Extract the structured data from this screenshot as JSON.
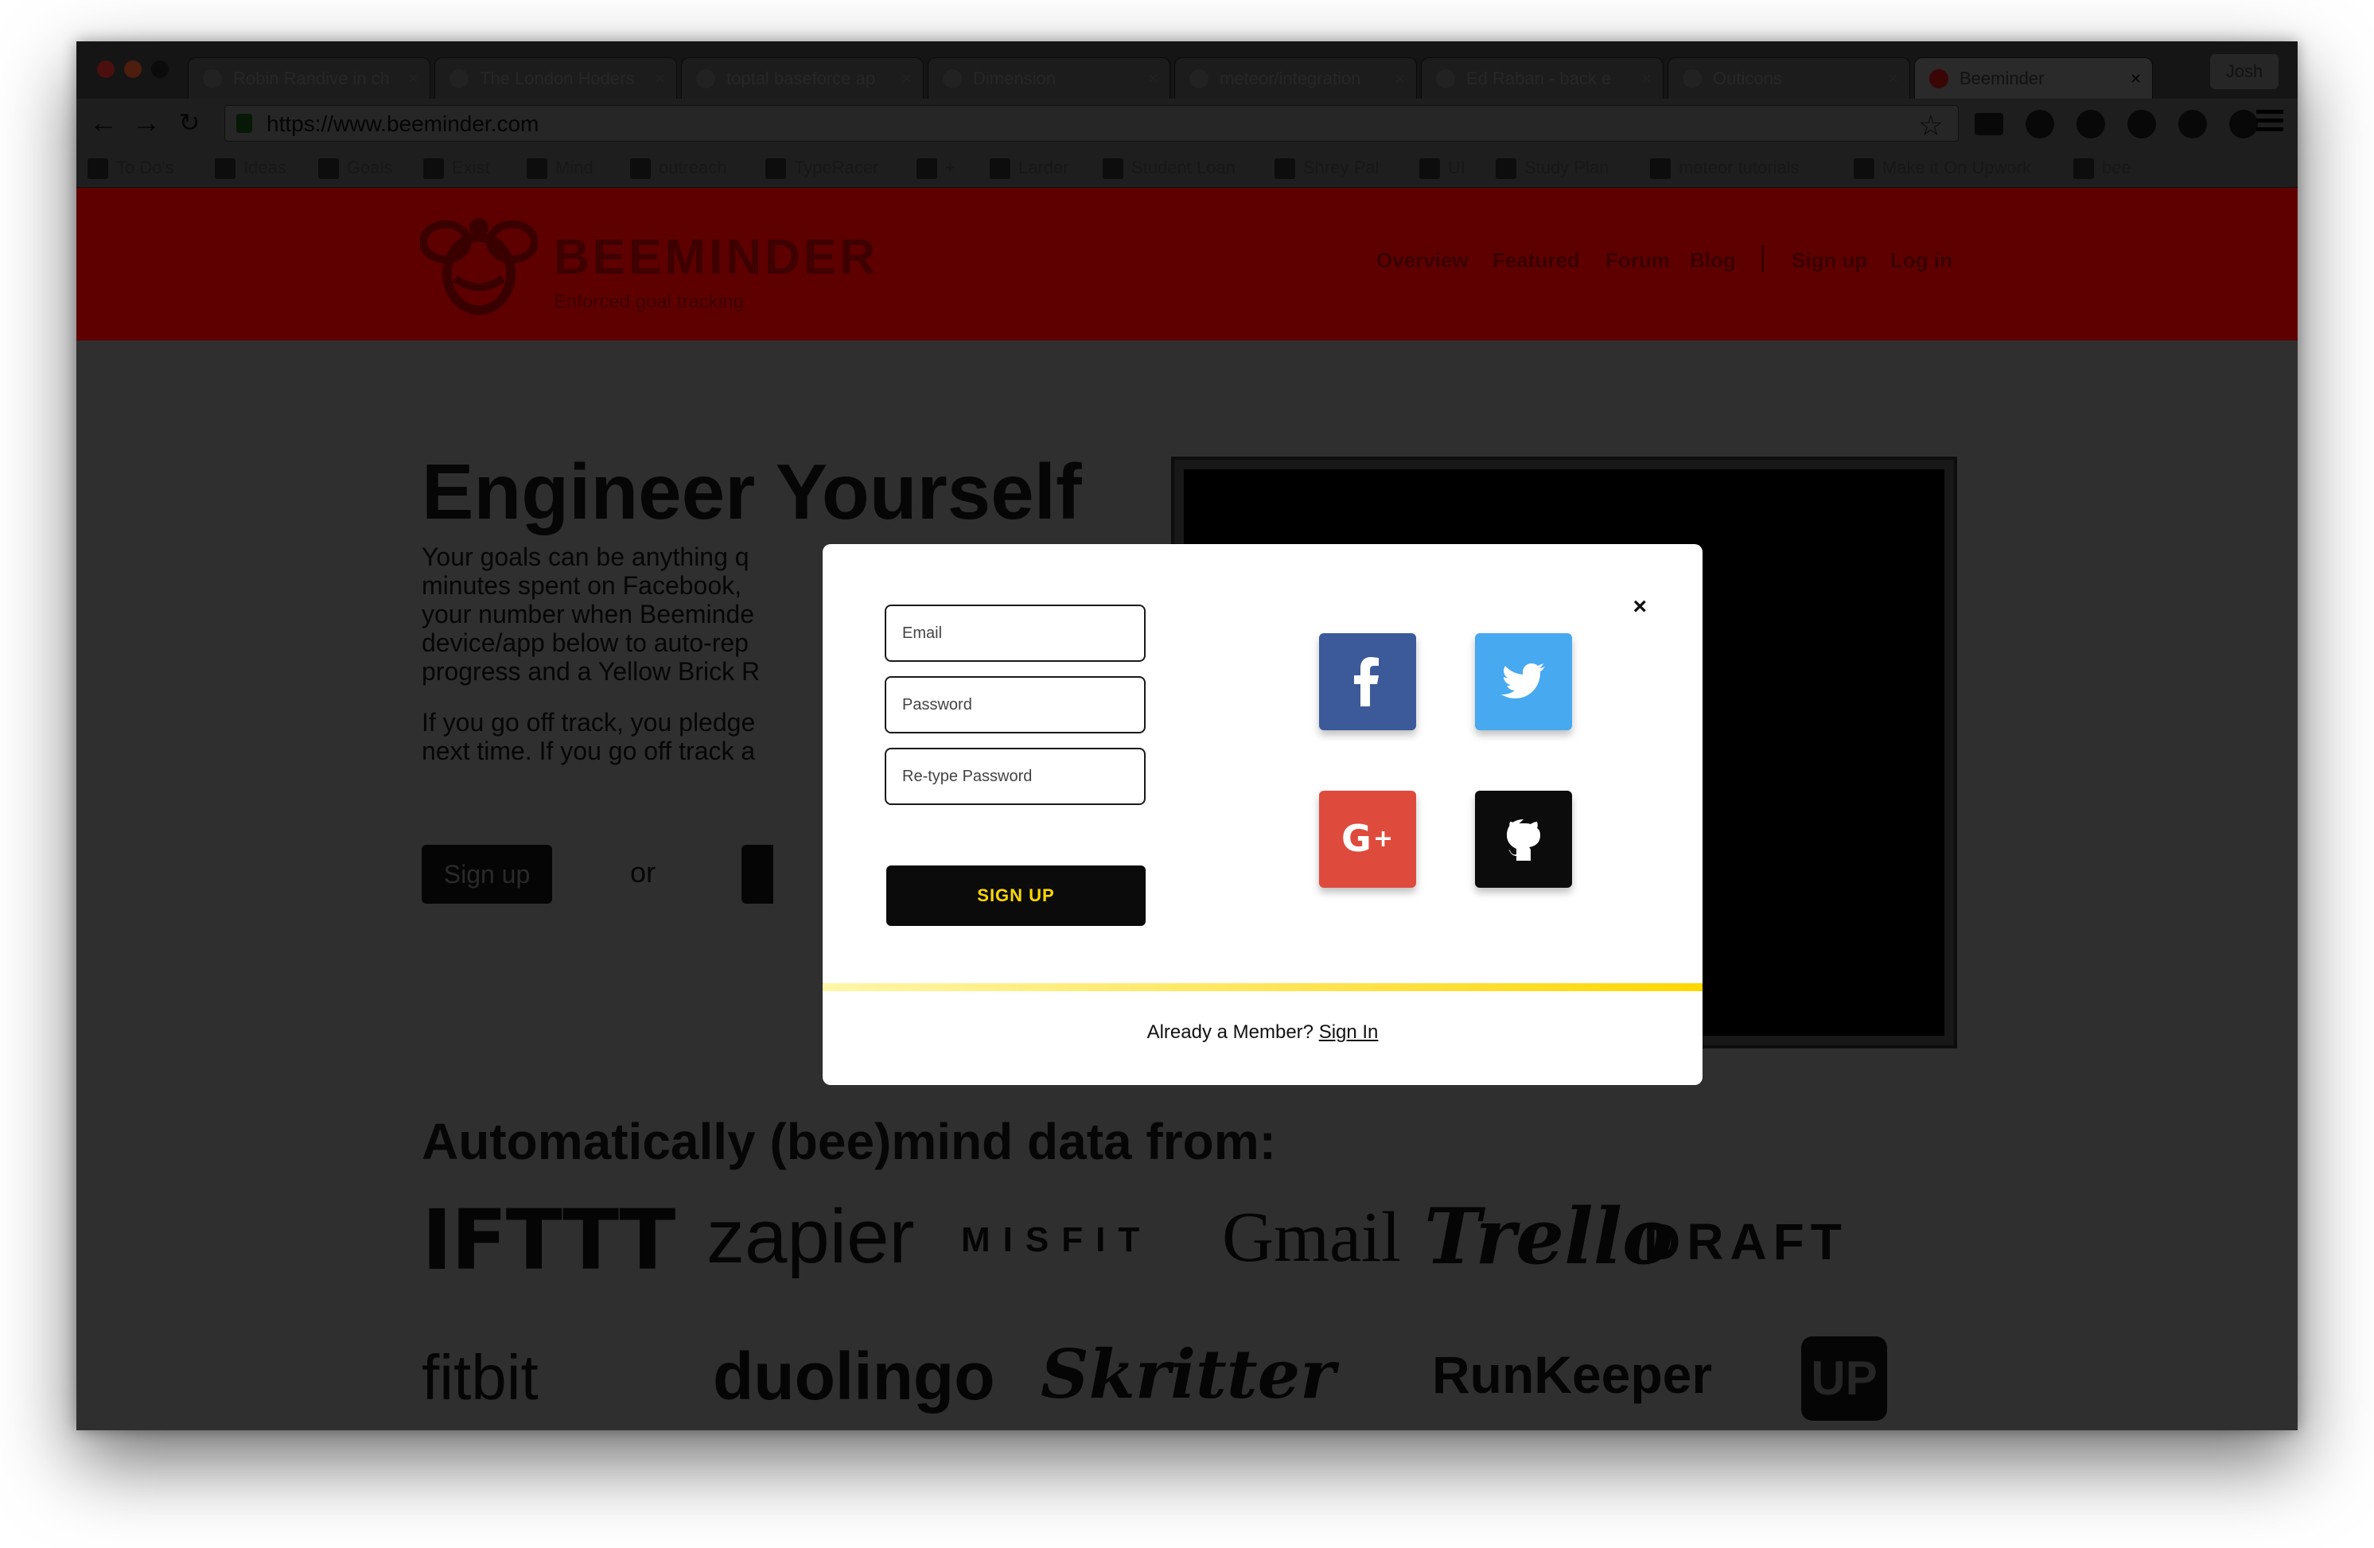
{
  "browser": {
    "tabs": [
      {
        "label": "Robin Randive in ch"
      },
      {
        "label": "The London Hoders"
      },
      {
        "label": "toptal baseforce ap"
      },
      {
        "label": "Dimension"
      },
      {
        "label": "meteor/integration"
      },
      {
        "label": "Ed Raban - back e"
      },
      {
        "label": "Outicons"
      },
      {
        "label": "Beeminder"
      }
    ],
    "profile": "Josh",
    "url": "https://www.beeminder.com",
    "bookmarks": [
      {
        "label": "To Do's"
      },
      {
        "label": "Ideas"
      },
      {
        "label": "Goals"
      },
      {
        "label": "Exist"
      },
      {
        "label": "Mind"
      },
      {
        "label": "outreach"
      },
      {
        "label": "TypeRacer"
      },
      {
        "label": "+"
      },
      {
        "label": "Larder"
      },
      {
        "label": "Student Loan"
      },
      {
        "label": "Shrey Pal"
      },
      {
        "label": "UI"
      },
      {
        "label": "Study Plan"
      },
      {
        "label": "meteor tutorials"
      },
      {
        "label": "Make it On Upwork"
      },
      {
        "label": "bee"
      }
    ]
  },
  "site": {
    "logo": "BEEMINDER",
    "tagline": "Enforced goal tracking",
    "nav": [
      "Overview",
      "Featured",
      "Forum",
      "Blog",
      "Sign up",
      "Log in"
    ],
    "hero_title": "Engineer Yourself",
    "hero_text_1": "Your goals can be anything q minutes spent on Facebook, your number when Beeminde device/app below to auto-rep progress and a Yellow Brick R",
    "hero_text_2": "If you go off track, you pledge next time. If you go off track a",
    "cta_signup": "Sign up",
    "cta_or": "or",
    "auto_title": "Automatically (bee)mind data from:",
    "integrations": [
      "IFTTT",
      "zapier",
      "MISFIT",
      "Gmail",
      "Trello",
      "DRAFT",
      "fitbit",
      "duolingo",
      "Skritter",
      "RunKeeper",
      "UP"
    ]
  },
  "modal": {
    "email_placeholder": "Email",
    "password_placeholder": "Password",
    "retype_placeholder": "Re-type Password",
    "signup_label": "SIGN UP",
    "close": "×",
    "footer_text": "Already a Member?",
    "footer_link": "Sign In"
  },
  "colors": {
    "facebook": "#3c5a9a",
    "twitter": "#47a9f0",
    "google": "#de4b3c",
    "github": "#0c0c0c",
    "accent_yellow": "#ffd800"
  }
}
